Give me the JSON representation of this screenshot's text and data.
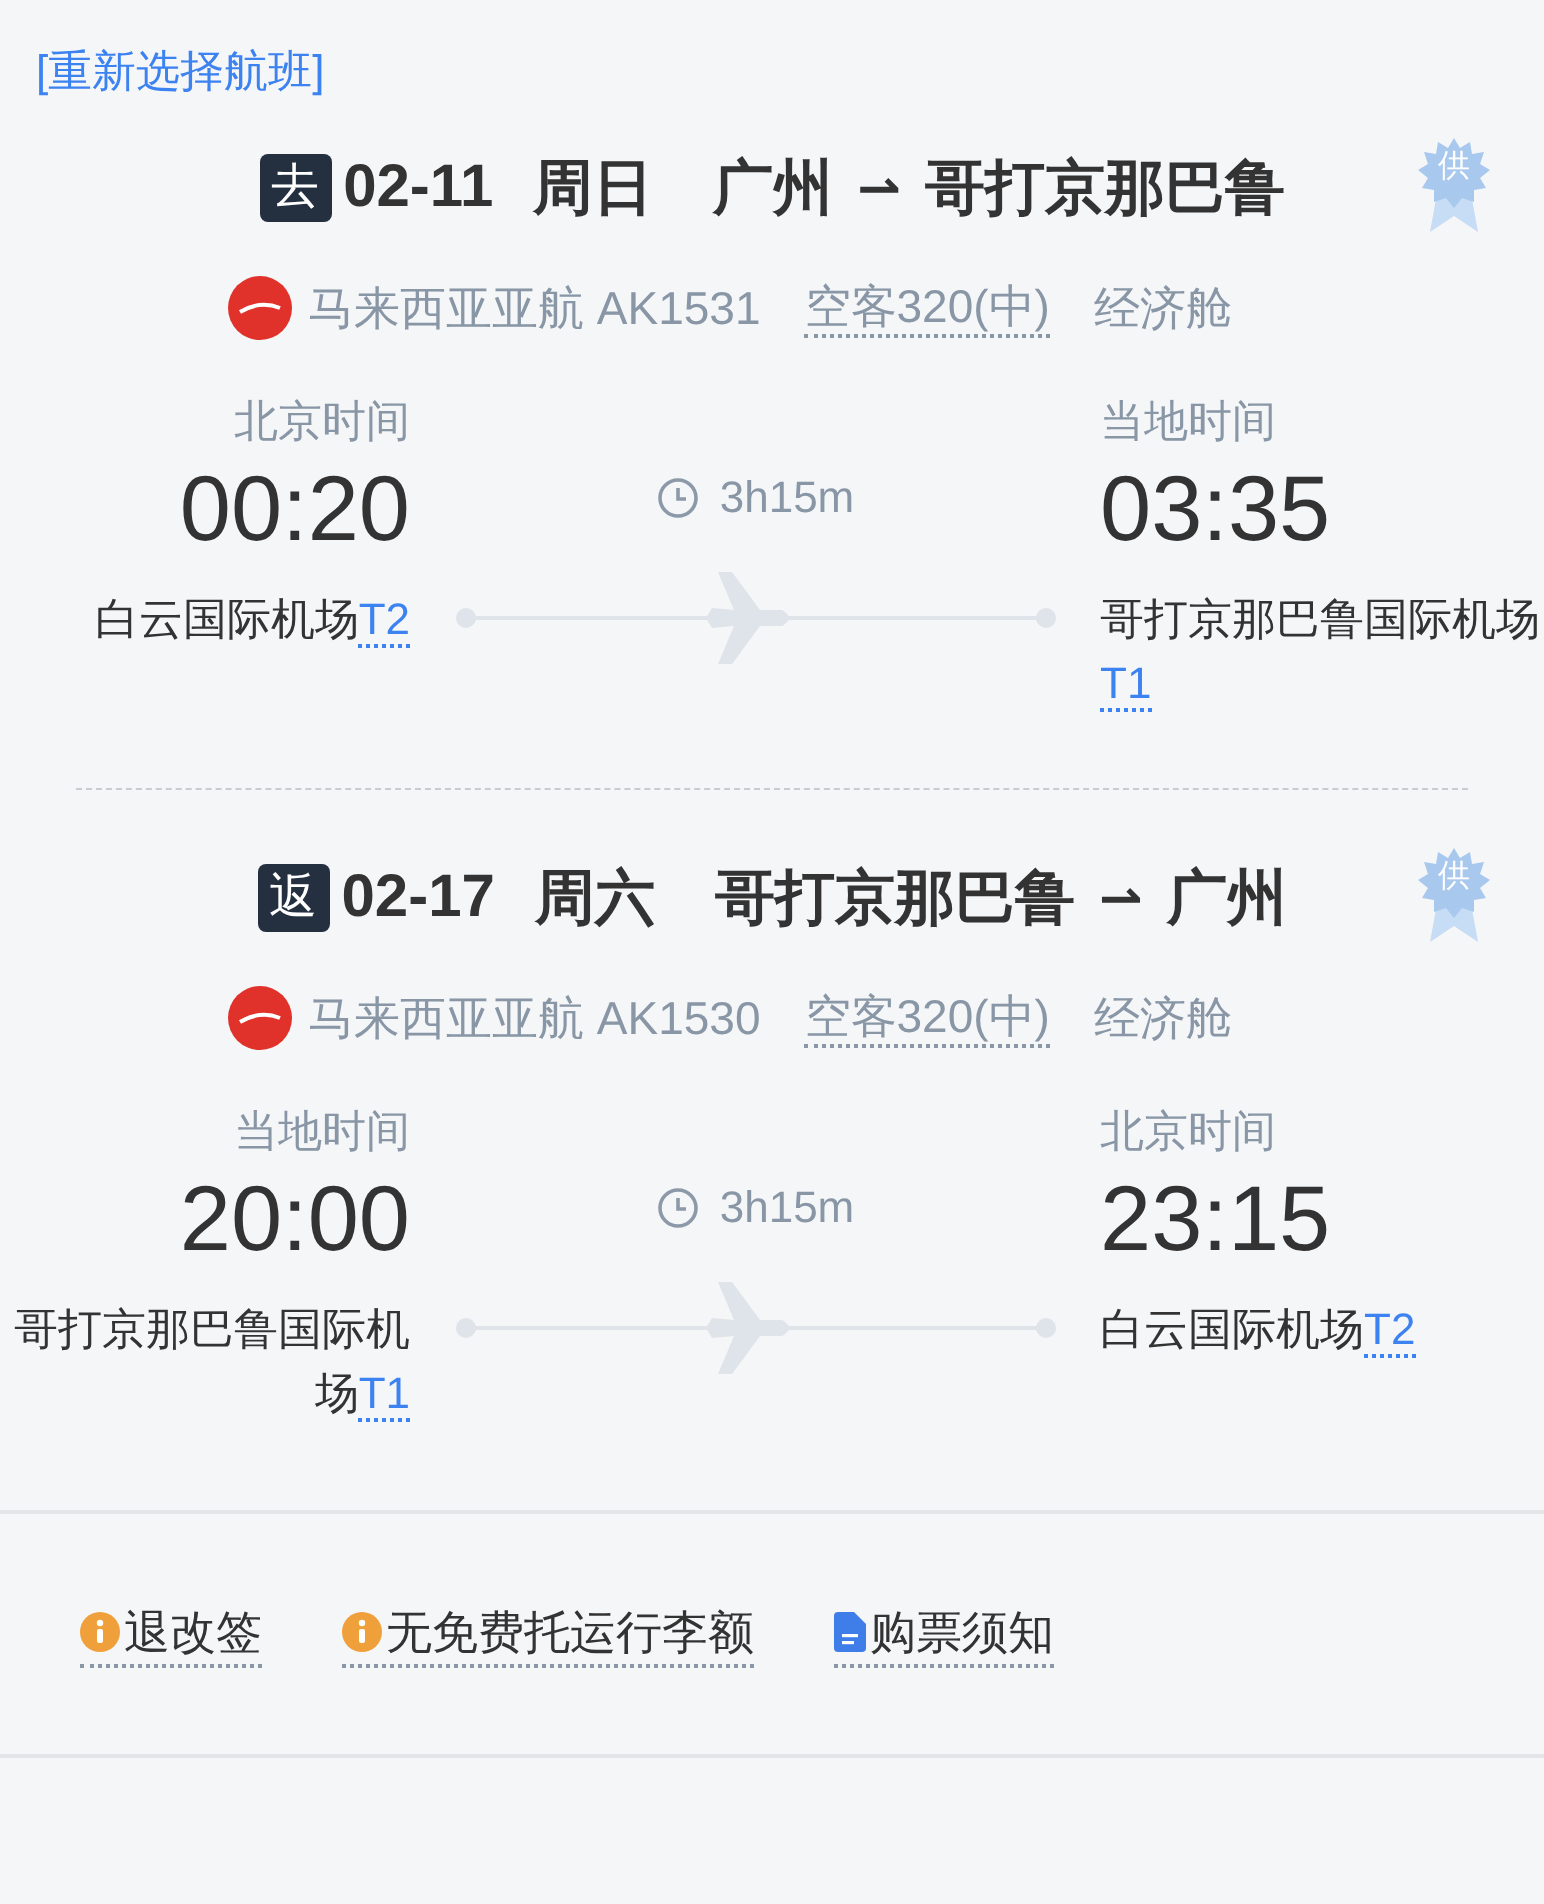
{
  "reselect_link": "[重新选择航班]",
  "flights": [
    {
      "badge": "去",
      "date": "02-11",
      "weekday": "周日",
      "from": "广州",
      "arrow": "⇀",
      "to": "哥打京那巴鲁",
      "supplier_badge": "供",
      "airline": "马来西亚亚航 AK1531",
      "aircraft": "空客320(中)",
      "cabin": "经济舱",
      "duration": "3h15m",
      "departure": {
        "zone": "北京时间",
        "time": "00:20",
        "airport": "白云国际机场",
        "terminal": "T2"
      },
      "arrival": {
        "zone": "当地时间",
        "time": "03:35",
        "airport": "哥打京那巴鲁国际机场",
        "terminal": "T1"
      }
    },
    {
      "badge": "返",
      "date": "02-17",
      "weekday": "周六",
      "from": "哥打京那巴鲁",
      "arrow": "⇀",
      "to": "广州",
      "supplier_badge": "供",
      "airline": "马来西亚亚航 AK1530",
      "aircraft": "空客320(中)",
      "cabin": "经济舱",
      "duration": "3h15m",
      "departure": {
        "zone": "当地时间",
        "time": "20:00",
        "airport": "哥打京那巴鲁国际机场",
        "terminal": "T1"
      },
      "arrival": {
        "zone": "北京时间",
        "time": "23:15",
        "airport": "白云国际机场",
        "terminal": "T2"
      }
    }
  ],
  "footer_links": [
    {
      "kind": "info",
      "label": "退改签"
    },
    {
      "kind": "info",
      "label": "无免费托运行李额"
    },
    {
      "kind": "doc",
      "label": "购票须知"
    }
  ]
}
